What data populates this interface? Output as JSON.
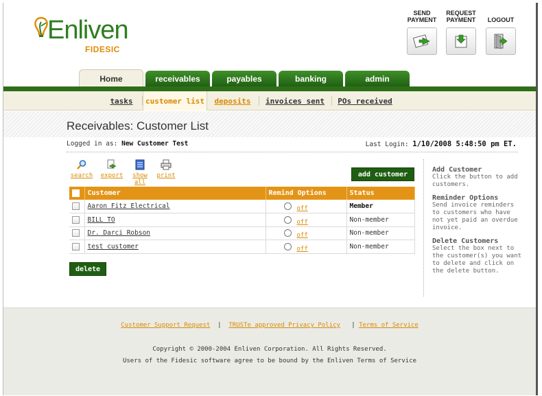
{
  "brand": {
    "name": "Enliven",
    "sub": "FIDESIC"
  },
  "topnav": [
    {
      "label_line1": "SEND",
      "label_line2": "PAYMENT",
      "icon": "send-payment-icon"
    },
    {
      "label_line1": "REQUEST",
      "label_line2": "PAYMENT",
      "icon": "request-payment-icon"
    },
    {
      "label_line1": "",
      "label_line2": "LOGOUT",
      "icon": "logout-icon"
    }
  ],
  "tabs": [
    {
      "label": "Home",
      "active": true
    },
    {
      "label": "receivables"
    },
    {
      "label": "payables"
    },
    {
      "label": "banking"
    },
    {
      "label": "admin"
    }
  ],
  "subtabs": [
    {
      "label": "tasks"
    },
    {
      "label": "customer list",
      "selected": true
    },
    {
      "label": "deposits"
    },
    {
      "label": "invoices sent"
    },
    {
      "label": "POs received"
    }
  ],
  "page": {
    "title": "Receivables: Customer List",
    "logged_in_label": "Logged in as:",
    "logged_in_user": "New Customer Test",
    "last_login_label": "Last Login:",
    "last_login_value": "1/10/2008 5:48:50 pm ET."
  },
  "toolbar": {
    "search": "search",
    "export": "export",
    "show_all": "show all",
    "print": "print",
    "add_customer": "add customer"
  },
  "table": {
    "headers": {
      "customer": "Customer",
      "remind": "Remind Options",
      "status": "Status"
    },
    "rows": [
      {
        "customer": "Aaron Fitz Electrical",
        "remind": "off",
        "status": "Member"
      },
      {
        "customer": "BILL TO",
        "remind": "off",
        "status": "Non-member"
      },
      {
        "customer": "Dr. Darci Robson",
        "remind": "off",
        "status": "Non-member"
      },
      {
        "customer": "test customer",
        "remind": "off",
        "status": "Non-member"
      }
    ]
  },
  "delete_label": "delete",
  "sidebar": [
    {
      "heading": "Add Customer",
      "text": "Click the button to add customers."
    },
    {
      "heading": "Reminder Options",
      "text": "Send invoice reminders to customers who have not yet paid an overdue invoice."
    },
    {
      "heading": "Delete Customers",
      "text": "Select the box next to the customer(s) you want to delete and click on the delete button."
    }
  ],
  "footer": {
    "link1": "Customer Support Request",
    "sep1": "|",
    "link2": "TRUSTe approved Privacy Policy",
    "sep2": "|",
    "link3": "Terms of Service",
    "copyright": "Copyright © 2000-2004 Enliven Corporation. All Rights Reserved.",
    "terms_note": "Users of the Fidesic software agree to be bound by the Enliven Terms of Service"
  },
  "colors": {
    "green": "#2e6e18",
    "orange": "#e39416",
    "link_orange": "#d88a00"
  }
}
